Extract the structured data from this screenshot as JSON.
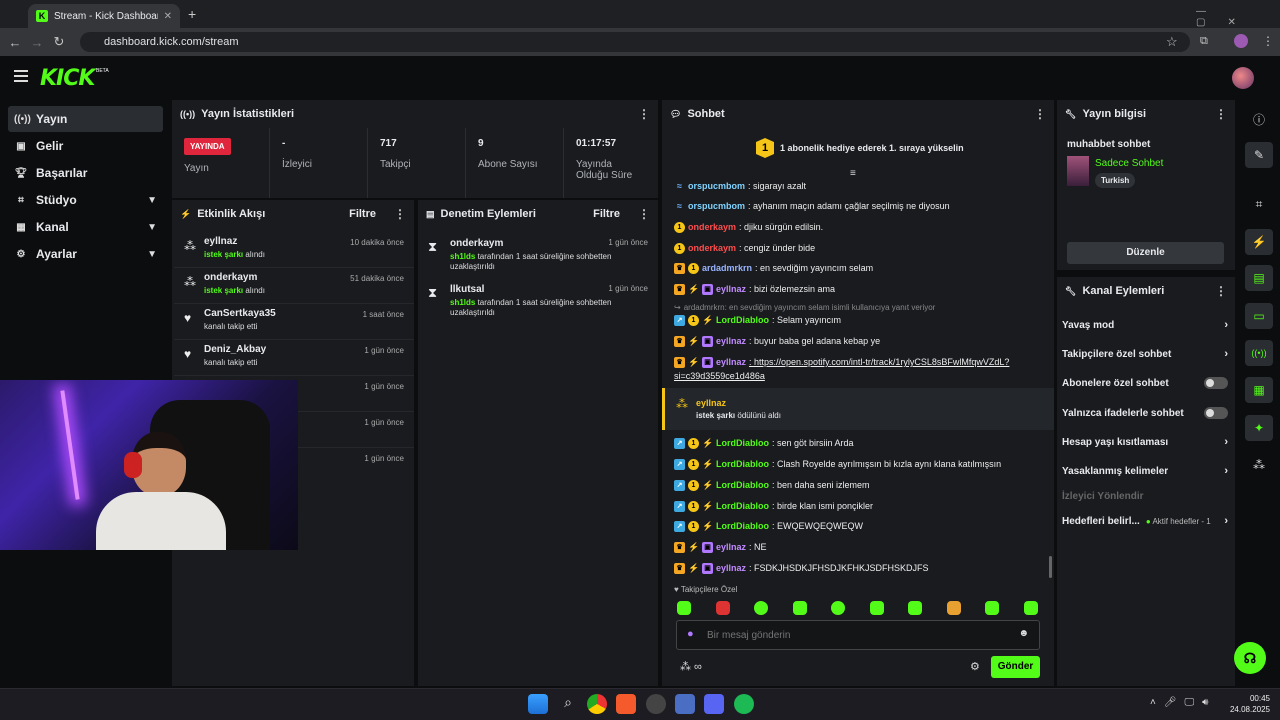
{
  "browser": {
    "tab_title": "Stream - Kick Dashboard",
    "url": "dashboard.kick.com/stream"
  },
  "brand": {
    "logo": "KICK",
    "beta": "BETA",
    "accent": "#53fc18"
  },
  "sidebar": {
    "items": [
      {
        "label": "Yayın",
        "icon": "broadcast-icon"
      },
      {
        "label": "Gelir",
        "icon": "revenue-icon"
      },
      {
        "label": "Başarılar",
        "icon": "trophy-icon"
      },
      {
        "label": "Stüdyo",
        "icon": "studio-icon"
      },
      {
        "label": "Kanal",
        "icon": "channel-icon"
      },
      {
        "label": "Ayarlar",
        "icon": "gear-icon"
      }
    ]
  },
  "stats": {
    "title": "Yayın İstatistikleri",
    "live_badge": "YAYINDA",
    "cells": [
      {
        "value": "",
        "label": "Yayın"
      },
      {
        "value": "-",
        "label": "İzleyici"
      },
      {
        "value": "717",
        "label": "Takipçi"
      },
      {
        "value": "9",
        "label": "Abone Sayısı"
      },
      {
        "value": "01:17:57",
        "label": "Yayında Olduğu Süre"
      }
    ]
  },
  "activity": {
    "title": "Etkinlik Akışı",
    "filter": "Filtre",
    "rows": [
      {
        "name": "eyllnaz",
        "desc_b": "istek şarkı",
        "desc": " alındı",
        "time": "10 dakika önce"
      },
      {
        "name": "onderkaym",
        "desc_b": "istek şarkı",
        "desc": " alındı",
        "time": "51 dakika önce"
      },
      {
        "name": "CanSertkaya35",
        "desc_b": "",
        "desc": "kanalı takip etti",
        "time": "1 saat önce"
      },
      {
        "name": "Deniz_Akbay",
        "desc_b": "",
        "desc": "kanalı takip etti",
        "time": "1 gün önce"
      },
      {
        "name": "",
        "desc_b": "",
        "desc": "",
        "time": "1 gün önce"
      },
      {
        "name": "",
        "desc_b": "",
        "desc": "",
        "time": "1 gün önce"
      },
      {
        "name": "",
        "desc_b": "",
        "desc": "",
        "time": "1 gün önce"
      }
    ]
  },
  "moderation": {
    "title": "Denetim Eylemleri",
    "filter": "Filtre",
    "rows": [
      {
        "name": "onderkaym",
        "by": "sh1lds",
        "desc": " tarafından 1 saat süreliğine sohbetten uzaklaştırıldı",
        "time": "1 gün önce"
      },
      {
        "name": "llkutsal",
        "by": "sh1lds",
        "desc": " tarafından 1 saat süreliğine sohbetten uzaklaştırıldı",
        "time": "1 gün önce"
      }
    ]
  },
  "chat": {
    "title": "Sohbet",
    "pinned": "1 abonelik hediye ederek 1. sıraya yükselin",
    "messages": [
      {
        "user": "orspucmbom",
        "color": "#7fd3ff",
        "text": ": sigarayı azalt"
      },
      {
        "user": "orspucmbom",
        "color": "#7fd3ff",
        "text": ": ayhanım maçın adamı çağlar seçilmiş ne diyosun"
      },
      {
        "user": "onderkaym",
        "color": "#ff4d4d",
        "text": ": djiku sürgün edilsin."
      },
      {
        "user": "onderkaym",
        "color": "#ff4d4d",
        "text": ": cengiz ünder bide"
      },
      {
        "user": "ardadmrkrn",
        "color": "#9ab4ff",
        "text": ": en sevdiğim yayıncım selam"
      },
      {
        "user": "eyllnaz",
        "color": "#c28bff",
        "text": ": bizi özlemezsin ama"
      },
      {
        "user": "LordDiabloo",
        "color": "#53fc18",
        "text": ": Selam yayıncım"
      },
      {
        "user": "eyllnaz",
        "color": "#c28bff",
        "text": ": buyur baba gel adana kebap ye"
      },
      {
        "user": "eyllnaz",
        "color": "#c28bff",
        "text": ": https://open.spotify.com/intl-tr/track/1rylyCSL8sBFwlMfqwVZdL?"
      },
      {
        "user": "LordDiabloo",
        "color": "#53fc18",
        "text": ": sen göt birsiin Arda"
      },
      {
        "user": "LordDiabloo",
        "color": "#53fc18",
        "text": ": Clash Royelde ayrılmışsın bi kızla aynı klana katılmışsın"
      },
      {
        "user": "LordDiabloo",
        "color": "#53fc18",
        "text": ": ben daha seni izlemem"
      },
      {
        "user": "LordDiabloo",
        "color": "#53fc18",
        "text": ": birde klan ismi ponçikler"
      },
      {
        "user": "LordDiabloo",
        "color": "#53fc18",
        "text": ": EWQEWQEQWEQW"
      },
      {
        "user": "eyllnaz",
        "color": "#c28bff",
        "text": ": NE"
      },
      {
        "user": "eyllnaz",
        "color": "#c28bff",
        "text": ": FSDKJHSDKJFHSDJKFHKJSDFHSKDJFS"
      }
    ],
    "link_cont": "si=c39d3559ce1d486a",
    "reply_hint": "ardadmrkrn: en sevdiğim yayıncım selam isimli kullanıcıya yanıt veriyor",
    "reward_user": "eyllnaz",
    "reward_b": "istek şarkı",
    "reward_text": " ödülünü aldı",
    "followers_only": "Takipçilere Özel",
    "input_placeholder": "Bir mesaj gönderin",
    "send": "Gönder"
  },
  "stream_info": {
    "title": "Yayın bilgisi",
    "stream_title": "muhabbet sohbet",
    "category": "Sadece Sohbet",
    "tag": "Turkish",
    "edit": "Düzenle"
  },
  "channel_actions": {
    "title": "Kanal Eylemleri",
    "items": [
      {
        "label": "Yavaş mod",
        "kind": "arrow"
      },
      {
        "label": "Takipçilere özel sohbet",
        "kind": "arrow"
      },
      {
        "label": "Abonelere özel sohbet",
        "kind": "toggle"
      },
      {
        "label": "Yalnızca ifadelerle sohbet",
        "kind": "toggle"
      },
      {
        "label": "Hesap yaşı kısıtlaması",
        "kind": "arrow"
      },
      {
        "label": "Yasaklanmış kelimeler",
        "kind": "arrow"
      }
    ],
    "redirect": "İzleyici Yönlendir",
    "goals": "Hedefleri belirl...",
    "goals_active": "Aktif hedefler - 1"
  },
  "taskbar": {
    "time": "00:45",
    "date": "24.08.2025"
  }
}
